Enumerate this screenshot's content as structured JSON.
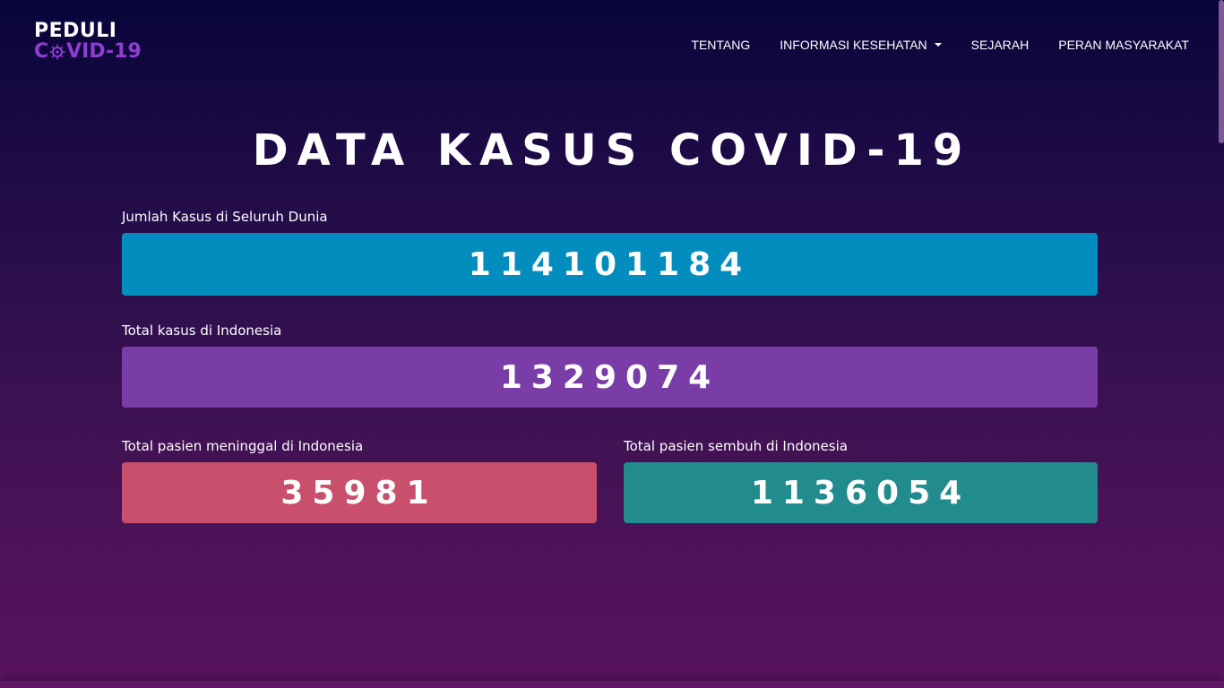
{
  "brand": {
    "line1": "PEDULI",
    "line2_prefix": "C",
    "line2_suffix": "VID-19",
    "icon": "virus-icon",
    "accent_color": "#8f3dcf"
  },
  "nav": {
    "items": [
      {
        "label": "TENTANG"
      },
      {
        "label": "INFORMASI KESEHATAN",
        "dropdown": true
      },
      {
        "label": "SEJARAH"
      },
      {
        "label": "PERAN MASYARAKAT"
      }
    ]
  },
  "main": {
    "title": "DATA KASUS COVID-19",
    "world": {
      "label": "Jumlah Kasus di Seluruh Dunia",
      "value": "114101184",
      "color": "#038dbe"
    },
    "indonesia": {
      "label": "Total kasus di Indonesia",
      "value": "1329074",
      "color": "#7a3ca6"
    },
    "deaths": {
      "label": "Total pasien meninggal di Indonesia",
      "value": "35981",
      "color": "#c8506c"
    },
    "recovered": {
      "label": "Total pasien sembuh di Indonesia",
      "value": "1136054",
      "color": "#228b8d"
    }
  }
}
